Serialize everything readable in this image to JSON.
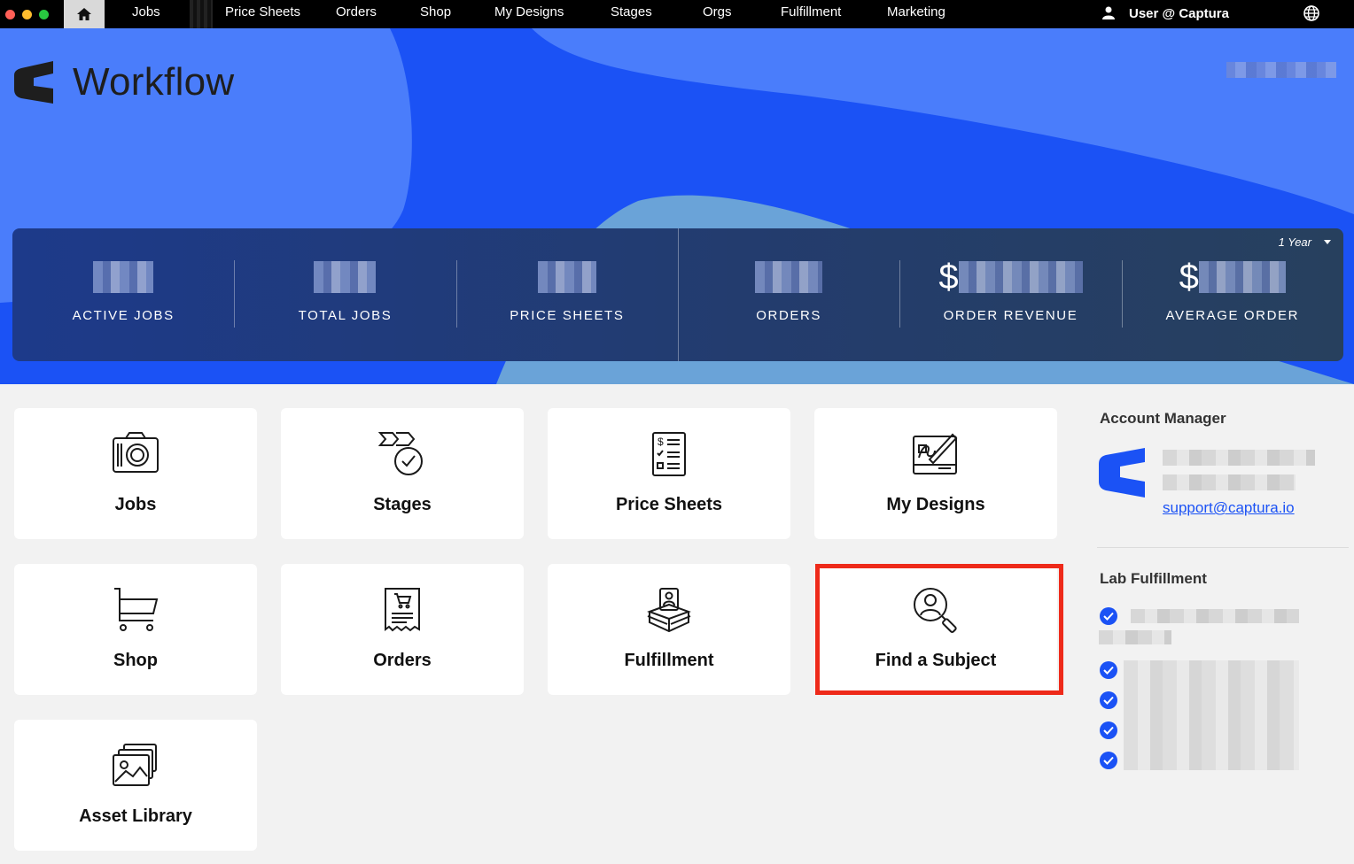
{
  "nav": {
    "items": [
      "Jobs",
      "Price Sheets",
      "Orders",
      "Shop",
      "My Designs",
      "Stages",
      "Orgs",
      "Fulfillment",
      "Marketing"
    ],
    "user_label": "User @ Captura"
  },
  "brand": {
    "name": "Workflow"
  },
  "stats": {
    "range_label": "1 Year",
    "items": [
      {
        "label": "ACTIVE JOBS",
        "prefix": ""
      },
      {
        "label": "TOTAL JOBS",
        "prefix": ""
      },
      {
        "label": "PRICE SHEETS",
        "prefix": ""
      },
      {
        "label": "ORDERS",
        "prefix": ""
      },
      {
        "label": "ORDER REVENUE",
        "prefix": "$"
      },
      {
        "label": "AVERAGE ORDER",
        "prefix": "$"
      }
    ]
  },
  "tiles": [
    {
      "label": "Jobs",
      "icon": "camera-icon"
    },
    {
      "label": "Stages",
      "icon": "stages-check-icon"
    },
    {
      "label": "Price Sheets",
      "icon": "price-list-icon"
    },
    {
      "label": "My Designs",
      "icon": "design-pen-icon"
    },
    {
      "label": "Shop",
      "icon": "cart-icon"
    },
    {
      "label": "Orders",
      "icon": "order-receipt-icon"
    },
    {
      "label": "Fulfillment",
      "icon": "package-icon"
    },
    {
      "label": "Find a Subject",
      "icon": "person-search-icon"
    },
    {
      "label": "Asset Library",
      "icon": "image-stack-icon"
    }
  ],
  "account_manager": {
    "title": "Account Manager",
    "email": "support@captura.io"
  },
  "lab": {
    "title": "Lab Fulfillment"
  },
  "colors": {
    "brand_blue": "#1b52f5",
    "highlight": "#ee2a1a"
  }
}
